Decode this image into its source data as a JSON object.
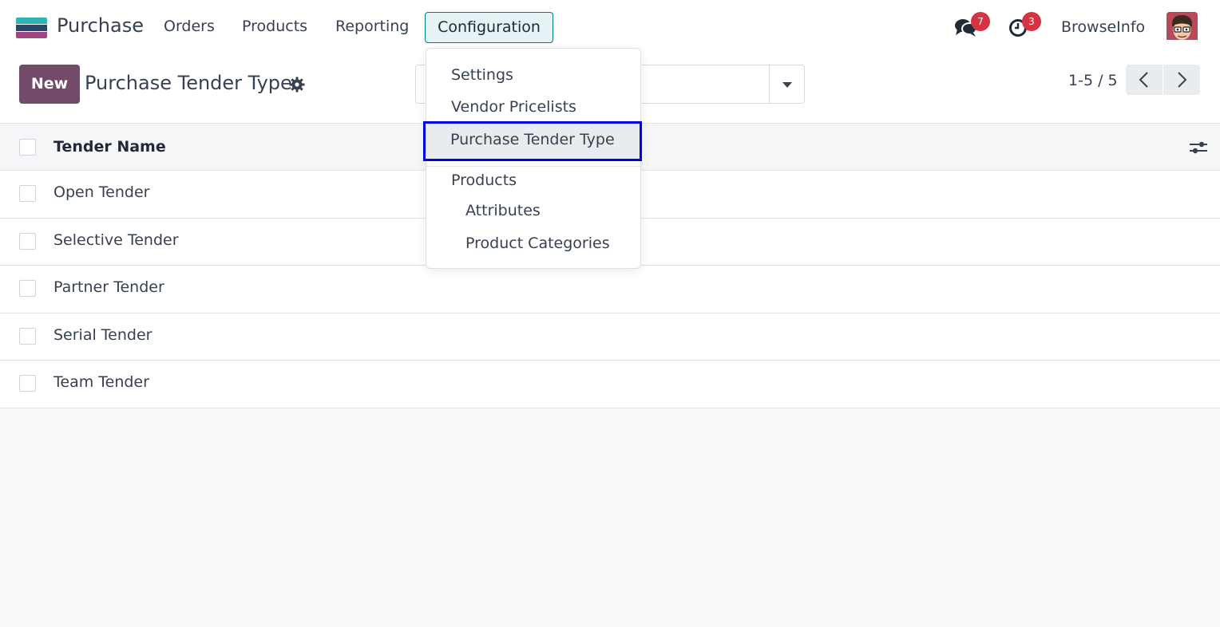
{
  "navbar": {
    "app_name": "Purchase",
    "menu": [
      "Orders",
      "Products",
      "Reporting",
      "Configuration"
    ],
    "messages_badge": "7",
    "activities_badge": "3",
    "company": "BrowseInfo",
    "icons": [
      "app-logo-icon",
      "chat-icon",
      "clock-icon",
      "avatar"
    ]
  },
  "control_panel": {
    "new_label": "New",
    "title": "Purchase Tender Type",
    "pager": "1-5 / 5"
  },
  "list": {
    "column_header": "Tender Name",
    "rows": [
      "Open Tender",
      "Selective Tender",
      "Partner Tender",
      "Serial Tender",
      "Team Tender"
    ]
  },
  "config_menu": {
    "items": [
      "Settings",
      "Vendor Pricelists",
      "Purchase Tender Type"
    ],
    "section": "Products",
    "sub_items": [
      "Attributes",
      "Product Categories"
    ],
    "active_item": "Purchase Tender Type"
  },
  "colors": {
    "brand": "#714b67",
    "accent": "#017e84",
    "badge": "#d63343",
    "highlight": "#0000e6"
  }
}
